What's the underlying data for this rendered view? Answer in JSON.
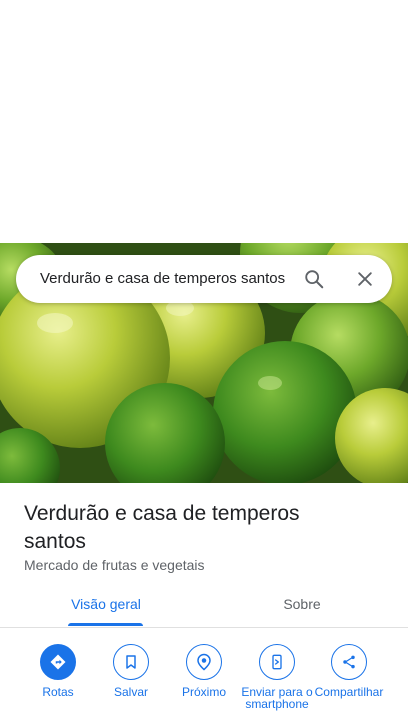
{
  "search": {
    "query": "Verdurão e casa de temperos santos"
  },
  "place": {
    "title": "Verdurão e casa de temperos santos",
    "category": "Mercado de frutas e vegetais"
  },
  "tabs": [
    {
      "label": "Visão geral",
      "selected": true
    },
    {
      "label": "Sobre",
      "selected": false
    }
  ],
  "actions": [
    {
      "label": "Rotas",
      "icon": "directions-icon"
    },
    {
      "label": "Salvar",
      "icon": "bookmark-icon"
    },
    {
      "label": "Próximo",
      "icon": "nearby-icon"
    },
    {
      "label": "Enviar para o smartphone",
      "icon": "send-to-phone-icon"
    },
    {
      "label": "Compartilhar",
      "icon": "share-icon"
    }
  ],
  "colors": {
    "accent": "#1a73e8",
    "text": "#202124",
    "secondary_text": "#5f6368"
  }
}
